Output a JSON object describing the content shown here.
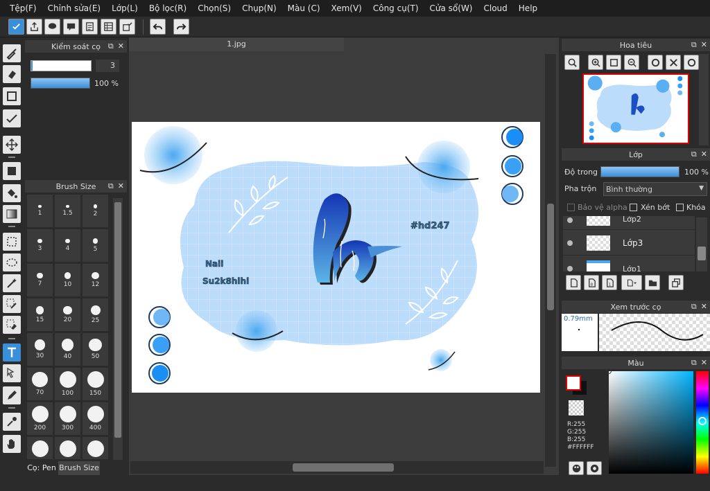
{
  "menu": [
    "Tệp(F)",
    "Chỉnh sửa(E)",
    "Lớp(L)",
    "Bộ lọc(R)",
    "Chọn(S)",
    "Chụp(N)",
    "Màu (C)",
    "Xem(V)",
    "Công cụ(T)",
    "Cửa sổ(W)",
    "Cloud",
    "Help"
  ],
  "brush_control": {
    "title": "Kiểm soát cọ",
    "size_value": "3",
    "opacity_value": "100 %"
  },
  "brush_size": {
    "title": "Brush Size",
    "sizes": [
      "1",
      "1.5",
      "2",
      "3",
      "4",
      "5",
      "7",
      "10",
      "12",
      "15",
      "20",
      "25",
      "30",
      "40",
      "50",
      "70",
      "100",
      "150",
      "200",
      "300",
      "400"
    ],
    "tab_pen": "Cọ: Pen",
    "tab_size": "Brush Size"
  },
  "document": {
    "tab": "1.jpg"
  },
  "art": {
    "hashtag": "#hd247",
    "name1": "Naii",
    "name2": "Su2k8hihi",
    "letter": "h"
  },
  "navigator": {
    "title": "Hoa tiêu"
  },
  "layers": {
    "title": "Lớp",
    "opacity_label": "Độ trong",
    "opacity_value": "100 %",
    "blend_label": "Pha trộn",
    "blend_value": "Bình thường",
    "protect_alpha": "Bảo vệ alpha",
    "clipping": "Xén bớt",
    "lock": "Khóa",
    "items": [
      "Lớp2",
      "Lớp3",
      "Lớp1"
    ]
  },
  "brush_preview": {
    "title": "Xem trước cọ",
    "size": "0.79mm"
  },
  "color": {
    "title": "Màu",
    "r": "R:255",
    "g": "G:255",
    "b": "B:255",
    "hex": "#FFFFFF",
    "accent": "#3a8fd9"
  }
}
